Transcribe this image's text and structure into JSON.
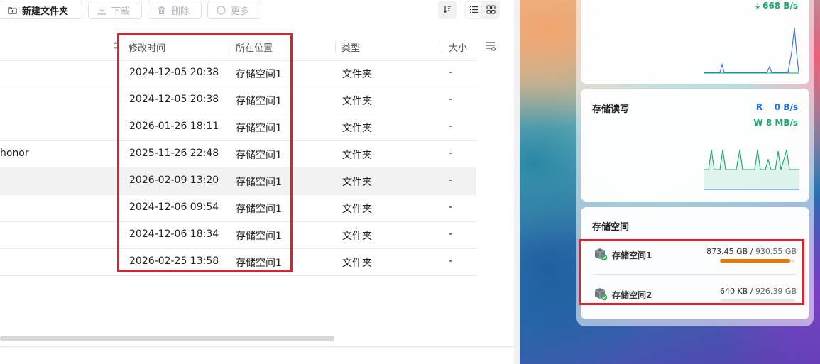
{
  "toolbar": {
    "new_folder": "新建文件夹",
    "download": "下载",
    "delete": "删除",
    "more": "更多"
  },
  "table": {
    "columns": {
      "modified": "修改时间",
      "location": "所在位置",
      "type": "类型",
      "size": "大小"
    },
    "rows": [
      {
        "name": "",
        "modified": "2024-12-05 20:38",
        "location": "存储空间1",
        "type": "文件夹",
        "size": "-"
      },
      {
        "name": "",
        "modified": "2024-12-05 20:38",
        "location": "存储空间1",
        "type": "文件夹",
        "size": "-"
      },
      {
        "name": "",
        "modified": "2026-01-26 18:11",
        "location": "存储空间1",
        "type": "文件夹",
        "size": "-"
      },
      {
        "name": "honor",
        "modified": "2025-11-26 22:48",
        "location": "存储空间1",
        "type": "文件夹",
        "size": "-"
      },
      {
        "name": "",
        "modified": "2026-02-09 13:20",
        "location": "存储空间1",
        "type": "文件夹",
        "size": "-",
        "highlighted": true
      },
      {
        "name": "",
        "modified": "2024-12-06 09:54",
        "location": "存储空间1",
        "type": "文件夹",
        "size": "-"
      },
      {
        "name": "",
        "modified": "2024-12-06 18:34",
        "location": "存储空间1",
        "type": "文件夹",
        "size": "-"
      },
      {
        "name": "",
        "modified": "2026-02-25 13:58",
        "location": "存储空间1",
        "type": "文件夹",
        "size": "-"
      }
    ]
  },
  "network": {
    "download_rate": "668 B/s",
    "colors": {
      "line": "#2f6fe0"
    }
  },
  "storage_io": {
    "title": "存储读写",
    "read_label": "R",
    "read_rate": "0 B/s",
    "write_label": "W",
    "write_rate": "8 MB/s",
    "colors": {
      "read": "#1a6fe6",
      "write": "#1aa56a"
    }
  },
  "storage_space": {
    "title": "存储空间",
    "disks": [
      {
        "name": "存储空间1",
        "used": "873.45 GB",
        "total": "930.55 GB",
        "fraction": 0.9386
      },
      {
        "name": "存储空间2",
        "used": "640 KB",
        "total": "926.39 GB",
        "fraction": 0.0
      }
    ]
  },
  "colors": {
    "annotation": "#e0202a",
    "bar_fill": "#e57a00"
  }
}
